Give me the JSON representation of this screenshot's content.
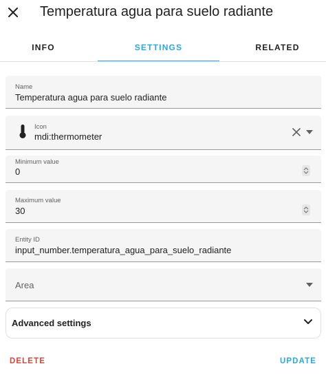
{
  "dialog": {
    "title": "Temperatura agua para suelo radiante",
    "close_icon": "close-icon"
  },
  "tabs": [
    {
      "label": "INFO",
      "active": false
    },
    {
      "label": "SETTINGS",
      "active": true
    },
    {
      "label": "RELATED",
      "active": false
    }
  ],
  "fields": {
    "name": {
      "label": "Name",
      "value": "Temperatura agua para suelo radiante"
    },
    "icon": {
      "label": "Icon",
      "value": "mdi:thermometer",
      "glyph": "thermometer-icon"
    },
    "minimum": {
      "label": "Minimum value",
      "value": "0"
    },
    "maximum": {
      "label": "Maximum value",
      "value": "30"
    },
    "entity_id": {
      "label": "Entity ID",
      "value": "input_number.temperatura_agua_para_suelo_radiante"
    },
    "area": {
      "placeholder": "Area"
    }
  },
  "advanced": {
    "label": "Advanced settings"
  },
  "footer": {
    "delete_label": "DELETE",
    "update_label": "UPDATE"
  },
  "colors": {
    "accent": "#2aa8e4",
    "danger": "#db4437",
    "field_bg": "#f5f5f5"
  }
}
